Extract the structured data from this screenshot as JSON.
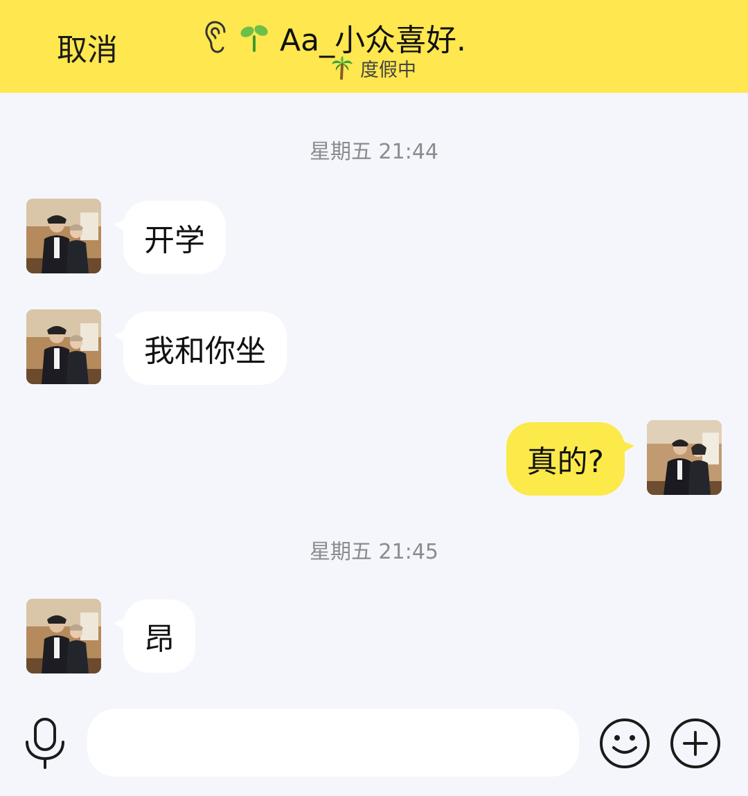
{
  "header": {
    "cancel_label": "取消",
    "title": "Aa_小众喜好.",
    "status_text": "度假中",
    "icons": [
      "ear-icon",
      "sprout-icon",
      "palm-tree-icon"
    ],
    "background": "#fee74f"
  },
  "messages": {
    "timestamp_1": "星期五 21:44",
    "msg_1": "开学",
    "msg_2": "我和你坐",
    "msg_3": "真的?",
    "timestamp_2": "星期五 21:45",
    "msg_4": "昂"
  },
  "input_bar": {
    "placeholder": "",
    "icons": [
      "microphone-icon",
      "emoji-icon",
      "plus-icon"
    ]
  },
  "colors": {
    "incoming_bubble": "#ffffff",
    "outgoing_bubble": "#fce94a",
    "chat_background": "#f5f6fb"
  }
}
